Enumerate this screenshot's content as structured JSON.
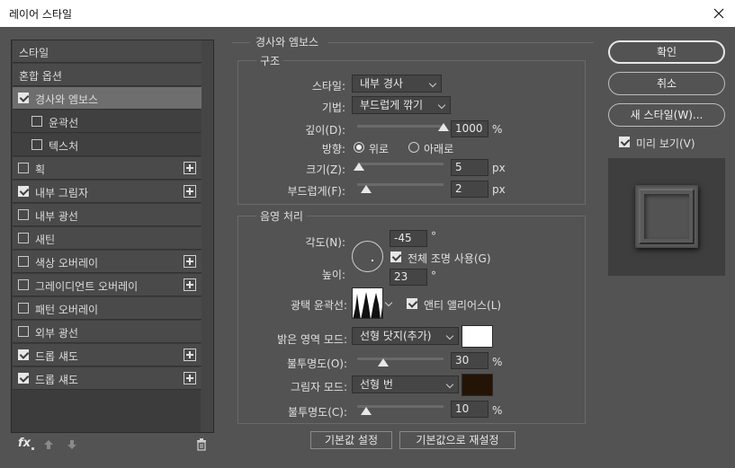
{
  "window": {
    "title": "레이어 스타일"
  },
  "styles_list": {
    "items": [
      {
        "label": "스타일",
        "checkbox": false,
        "checked": false,
        "plus": false,
        "sub": false,
        "selected": false
      },
      {
        "label": "혼합 옵션",
        "checkbox": false,
        "checked": false,
        "plus": false,
        "sub": false,
        "selected": false
      },
      {
        "label": "경사와 엠보스",
        "checkbox": true,
        "checked": true,
        "plus": false,
        "sub": false,
        "selected": true
      },
      {
        "label": "윤곽선",
        "checkbox": true,
        "checked": false,
        "plus": false,
        "sub": true,
        "selected": false
      },
      {
        "label": "텍스처",
        "checkbox": true,
        "checked": false,
        "plus": false,
        "sub": true,
        "selected": false
      },
      {
        "label": "획",
        "checkbox": true,
        "checked": false,
        "plus": true,
        "sub": false,
        "selected": false
      },
      {
        "label": "내부 그림자",
        "checkbox": true,
        "checked": true,
        "plus": true,
        "sub": false,
        "selected": false
      },
      {
        "label": "내부 광선",
        "checkbox": true,
        "checked": false,
        "plus": false,
        "sub": false,
        "selected": false
      },
      {
        "label": "새틴",
        "checkbox": true,
        "checked": false,
        "plus": false,
        "sub": false,
        "selected": false
      },
      {
        "label": "색상 오버레이",
        "checkbox": true,
        "checked": false,
        "plus": true,
        "sub": false,
        "selected": false
      },
      {
        "label": "그레이디언트 오버레이",
        "checkbox": true,
        "checked": false,
        "plus": true,
        "sub": false,
        "selected": false
      },
      {
        "label": "패턴 오버레이",
        "checkbox": true,
        "checked": false,
        "plus": false,
        "sub": false,
        "selected": false
      },
      {
        "label": "외부 광선",
        "checkbox": true,
        "checked": false,
        "plus": false,
        "sub": false,
        "selected": false
      },
      {
        "label": "드롭 섀도",
        "checkbox": true,
        "checked": true,
        "plus": true,
        "sub": false,
        "selected": false
      },
      {
        "label": "드롭 섀도",
        "checkbox": true,
        "checked": true,
        "plus": true,
        "sub": false,
        "selected": false
      }
    ]
  },
  "footer": {
    "fx_label": "fx"
  },
  "bevel": {
    "section_title": "경사와 엠보스",
    "structure": {
      "title": "구조",
      "style_label": "스타일:",
      "style_value": "내부 경사",
      "technique_label": "기법:",
      "technique_value": "부드럽게 깎기",
      "depth_label": "깊이(D):",
      "depth_value": "1000",
      "depth_percent": 1.0,
      "percent_unit": "%",
      "direction_label": "방향:",
      "direction_up": "위로",
      "direction_down": "아래로",
      "size_label": "크기(Z):",
      "size_value": "5",
      "size_percent": 0.02,
      "px_unit": "px",
      "soften_label": "부드럽게(F):",
      "soften_value": "2",
      "soften_percent": 0.1
    },
    "shading": {
      "title": "음영 처리",
      "angle_label": "각도(N):",
      "angle_value": "-45",
      "degree_unit": "°",
      "global_light_label": "전체 조명 사용(G)",
      "altitude_label": "높이:",
      "altitude_value": "23",
      "gloss_label": "광택 윤곽선:",
      "anti_alias_label": "앤티 앨리어스(L)",
      "highlight_mode_label": "밝은 영역 모드:",
      "highlight_mode_value": "선형 닷지(추가)",
      "highlight_color": "#ffffff",
      "highlight_opacity_label": "불투명도(O):",
      "highlight_opacity_value": "30",
      "highlight_opacity_percent": 0.3,
      "shadow_mode_label": "그림자 모드:",
      "shadow_mode_value": "선형 번",
      "shadow_color": "#241405",
      "shadow_opacity_label": "불투명도(C):",
      "shadow_opacity_value": "10",
      "shadow_opacity_percent": 0.1
    },
    "make_default": "기본값 설정",
    "reset_default": "기본값으로 재설정"
  },
  "actions": {
    "ok": "확인",
    "cancel": "취소",
    "new_style": "새 스타일(W)...",
    "preview": "미리 보기(V)"
  }
}
